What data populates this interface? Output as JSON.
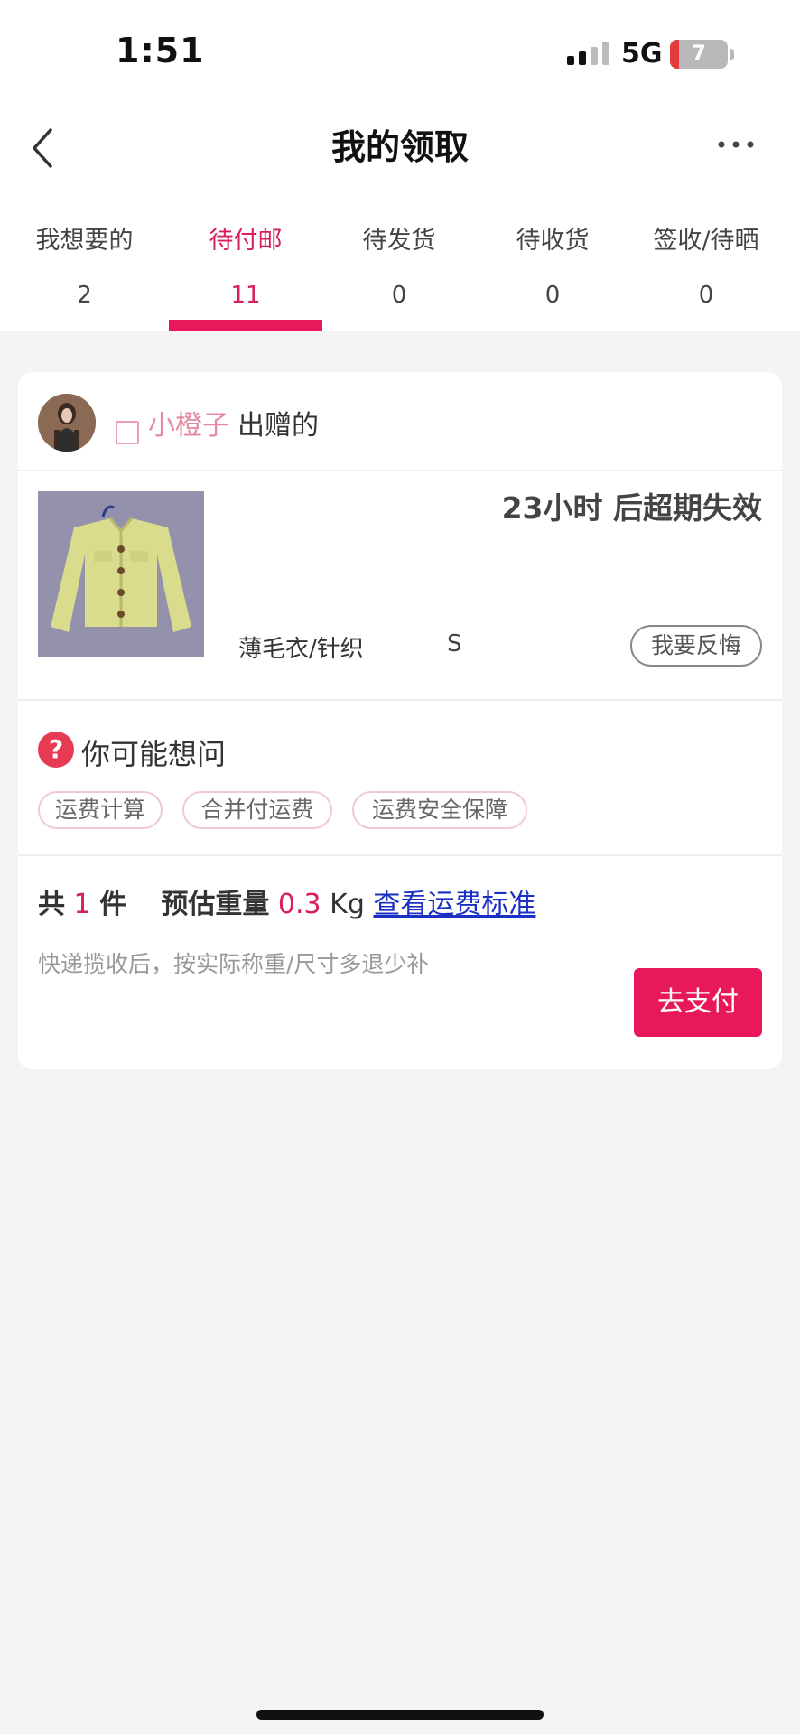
{
  "status_bar": {
    "time": "1:51",
    "network": "5G",
    "battery_level": "7",
    "battery_fraction": 0.07,
    "battery_color": "#e23c3c"
  },
  "nav": {
    "title": "我的领取",
    "back_icon": "chevron-left-icon",
    "more_icon": "more-horizontal-icon"
  },
  "tabs": [
    {
      "label": "我想要的",
      "count": "2",
      "active": false
    },
    {
      "label": "待付邮",
      "count": "11",
      "active": true
    },
    {
      "label": "待发货",
      "count": "0",
      "active": false
    },
    {
      "label": "待收货",
      "count": "0",
      "active": false
    },
    {
      "label": "签收/待晒",
      "count": "0",
      "active": false
    }
  ],
  "card": {
    "giver_name": "小橙子",
    "giver_suffix": "出赠的",
    "expire_text": "23小时 后超期失效",
    "item_category": "薄毛衣/针织",
    "item_size": "S",
    "regret_label": "我要反悔",
    "faq": {
      "icon": "help-icon",
      "title": "你可能想问",
      "chips": [
        "运费计算",
        "合并付运费",
        "运费安全保障"
      ]
    },
    "summary": {
      "total_prefix": "共",
      "total_count": "1",
      "total_suffix": "件",
      "weight_label": "预估重量",
      "weight_value": "0.3",
      "weight_unit": "Kg",
      "fee_link": "查看运费标准",
      "refund_note": "快递揽收后，按实际称重/尺寸多退少补",
      "pay_label": "去支付"
    }
  },
  "colors": {
    "accent": "#e8195a",
    "accent_text": "#d91e5c",
    "link": "#1a2fc4",
    "background": "#f4f4f5"
  }
}
